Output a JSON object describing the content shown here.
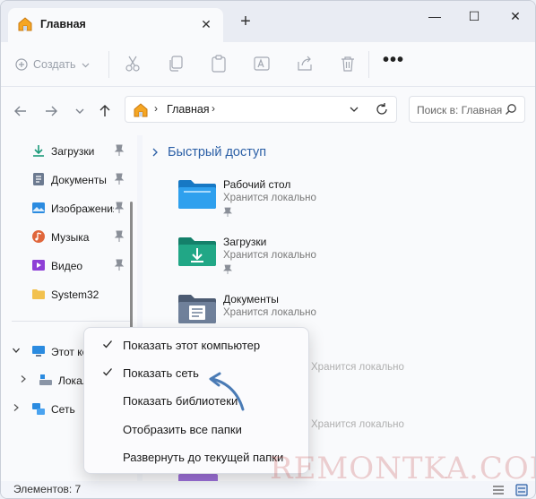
{
  "tab": {
    "title": "Главная",
    "close": "✕",
    "new_tab": "+"
  },
  "window_controls": {
    "minimize": "—",
    "maximize": "☐",
    "close": "✕"
  },
  "commandbar": {
    "create_label": "Создать",
    "icons": [
      "cut-icon",
      "copy-icon",
      "paste-icon",
      "rename-icon",
      "share-icon",
      "delete-icon"
    ],
    "more": "•••"
  },
  "address": {
    "location": "Главная",
    "separator": "›"
  },
  "search": {
    "placeholder": "Поиск в: Главная"
  },
  "sidebar": {
    "items": [
      {
        "label": "Загрузки",
        "icon": "download-icon",
        "pinned": true
      },
      {
        "label": "Документы",
        "icon": "document-icon",
        "pinned": true
      },
      {
        "label": "Изображения",
        "icon": "pictures-icon",
        "pinned": true
      },
      {
        "label": "Музыка",
        "icon": "music-icon",
        "pinned": true
      },
      {
        "label": "Видео",
        "icon": "video-icon",
        "pinned": true
      },
      {
        "label": "System32",
        "icon": "folder-icon",
        "pinned": false
      }
    ],
    "tree": [
      {
        "label": "Этот компьютер",
        "icon": "computer-icon",
        "expanded": true
      },
      {
        "label": "Локальный диск",
        "icon": "drive-icon",
        "expanded": false
      },
      {
        "label": "Сеть",
        "icon": "network-icon",
        "expanded": false
      }
    ]
  },
  "main": {
    "section_title": "Быстрый доступ",
    "folders": [
      {
        "name": "Рабочий стол",
        "subtitle": "Хранится локально",
        "color": "#1a8fe0"
      },
      {
        "name": "Загрузки",
        "subtitle": "Хранится локально",
        "color": "#1b9a7a"
      },
      {
        "name": "Документы",
        "subtitle": "Хранится локально",
        "color": "#5f7088"
      }
    ],
    "hidden_subtitle": "Хранится локально"
  },
  "context_menu": {
    "items": [
      {
        "label": "Показать этот компьютер",
        "checked": true
      },
      {
        "label": "Показать сеть",
        "checked": true
      },
      {
        "label": "Показать библиотеки",
        "checked": false
      },
      {
        "label": "Отобразить все папки",
        "checked": false
      },
      {
        "label": "Развернуть до текущей папки",
        "checked": false
      }
    ]
  },
  "status": {
    "items_count": "Элементов: 7"
  },
  "watermark": "REMONTKA.COM",
  "colors": {
    "accent": "#2b5fa6",
    "arrow": "#4a7bb5"
  }
}
